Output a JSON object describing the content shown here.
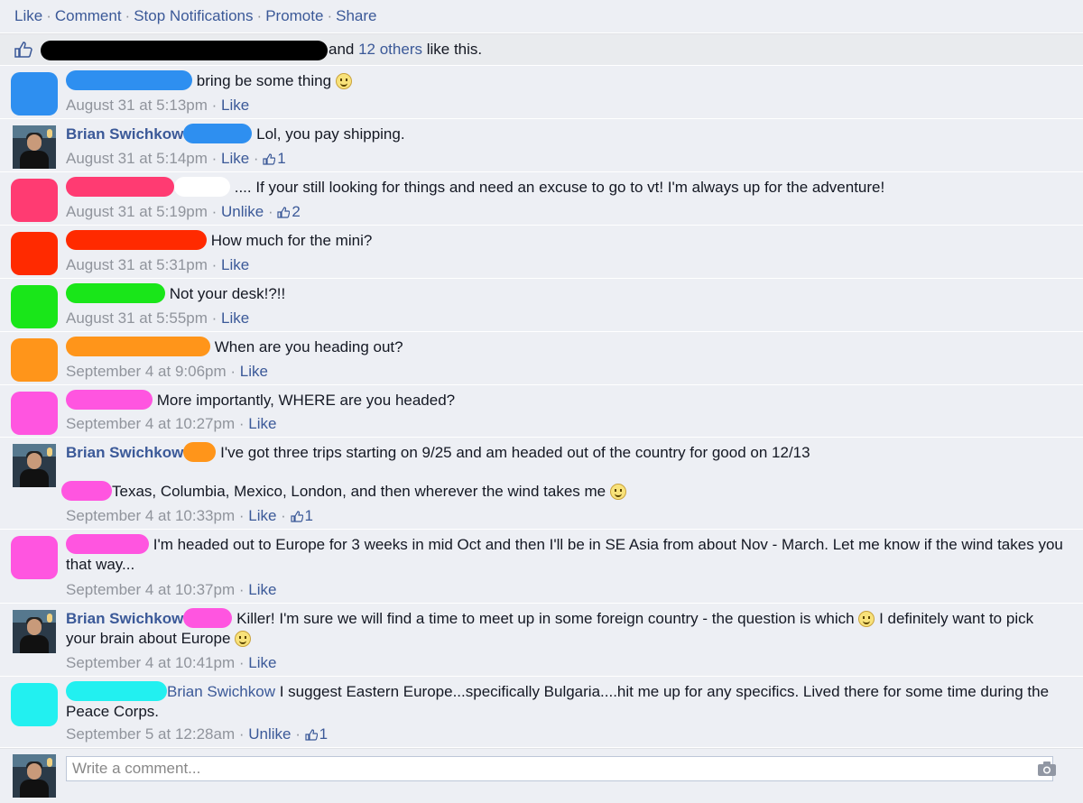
{
  "actions": {
    "like": "Like",
    "comment": "Comment",
    "stop_notifications": "Stop Notifications",
    "promote": "Promote",
    "share": "Share",
    "separator": "·"
  },
  "likes": {
    "others_link": "12 others",
    "text_prefix": "and ",
    "text_suffix": " like this."
  },
  "comments": [
    {
      "text": "bring be some thing",
      "time": "August 31 at 5:13pm",
      "action": "Like",
      "pill_color": "#2e8ff0",
      "avatar_color": "#2e8ff0"
    },
    {
      "author": "Brian Swichkow",
      "text": "Lol, you pay shipping.",
      "time": "August 31 at 5:14pm",
      "action": "Like",
      "likes": "1",
      "pill_color": "#2e8ff0"
    },
    {
      "text": ".... If your still looking for things and need an excuse to go to vt! I'm always up for the adventure!",
      "time": "August 31 at 5:19pm",
      "action": "Unlike",
      "likes": "2",
      "pill_color": "#ff3b72",
      "avatar_color": "#ff3b72"
    },
    {
      "text": "How much for the mini?",
      "time": "August 31 at 5:31pm",
      "action": "Like",
      "pill_color": "#ff2a00",
      "avatar_color": "#ff2a00"
    },
    {
      "text": "Not your desk!?!!",
      "time": "August 31 at 5:55pm",
      "action": "Like",
      "pill_color": "#19e619",
      "avatar_color": "#19e619"
    },
    {
      "text": "When are you heading out?",
      "time": "September 4 at 9:06pm",
      "action": "Like",
      "pill_color": "#ff951a",
      "avatar_color": "#ff951a"
    },
    {
      "text": "More importantly, WHERE are you headed?",
      "time": "September 4 at 10:27pm",
      "action": "Like",
      "pill_color": "#ff55e0",
      "avatar_color": "#ff55e0"
    },
    {
      "author": "Brian Swichkow",
      "text": "I've got three trips starting on 9/25 and am headed out of the country for good on 12/13",
      "text2": "Texas, Columbia, Mexico, London, and then wherever the wind takes me",
      "time": "September 4 at 10:33pm",
      "action": "Like",
      "likes": "1",
      "pill_color": "#ff951a",
      "pill2_color": "#ff55e0"
    },
    {
      "text": "I'm headed out to Europe for 3 weeks in mid Oct and then I'll be in SE Asia from about Nov - March. Let me know if the wind takes you that way...",
      "time": "September 4 at 10:37pm",
      "action": "Like",
      "pill_color": "#ff55e0",
      "avatar_color": "#ff55e0"
    },
    {
      "author": "Brian Swichkow",
      "text": "Killer! I'm sure we will find a time to meet up in some foreign country - the question is which",
      "text_b": "I definitely want to pick your brain about Europe",
      "time": "September 4 at 10:41pm",
      "action": "Like",
      "pill_color": "#ff55e0"
    },
    {
      "mention": "Brian Swichkow",
      "text": "I suggest Eastern Europe...specifically Bulgaria....hit me up for any specifics. Lived there for some time during the Peace Corps.",
      "time": "September 5 at 12:28am",
      "action": "Unlike",
      "likes": "1",
      "pill_color": "#22f0f0",
      "avatar_color": "#22f0f0"
    }
  ],
  "composer": {
    "placeholder": "Write a comment..."
  },
  "colors": {
    "link": "#3b5998",
    "meta": "#90949c",
    "background": "#edeff4"
  }
}
